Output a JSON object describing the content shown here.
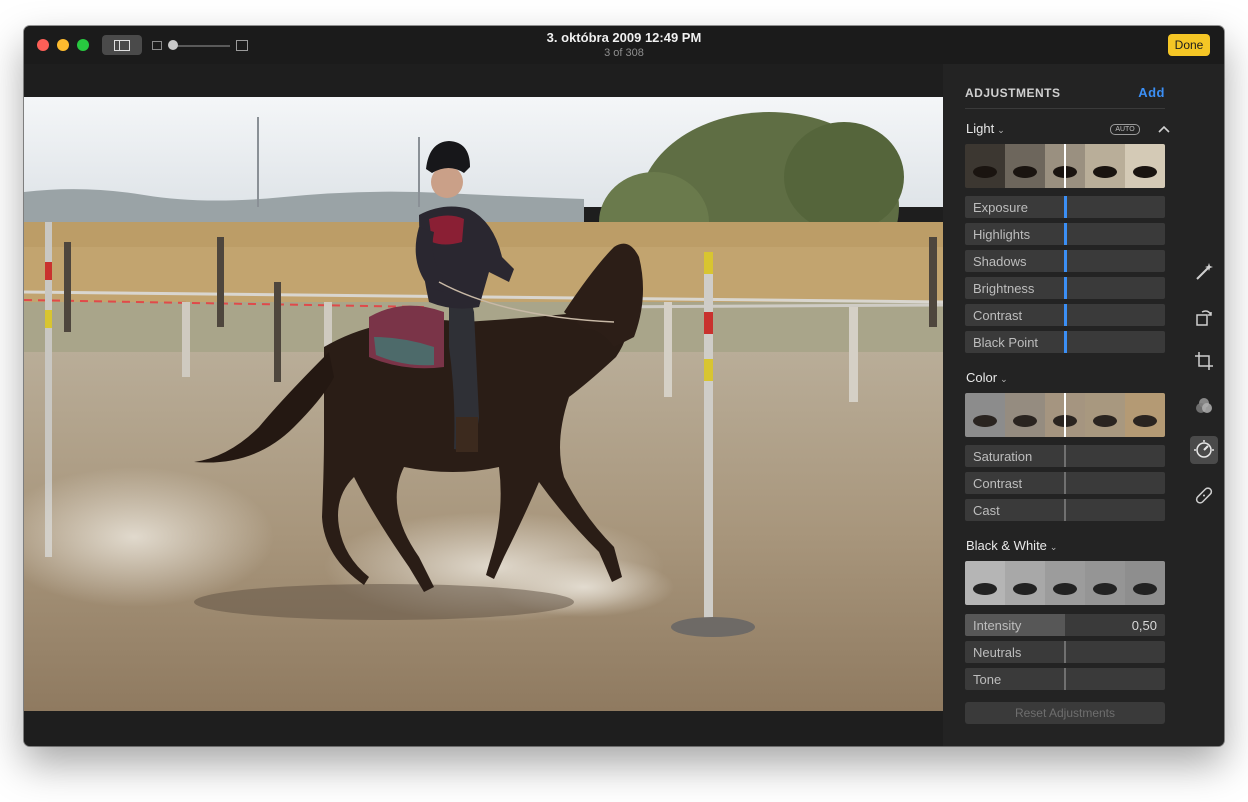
{
  "window": {
    "title": "3. októbra 2009 12:49 PM",
    "subtitle": "3 of 308",
    "done_label": "Done",
    "accent_color": "#f5c625"
  },
  "adjustments": {
    "header": "ADJUSTMENTS",
    "add_label": "Add",
    "light": {
      "title": "Light",
      "auto_label": "AUTO",
      "rows": [
        {
          "label": "Exposure"
        },
        {
          "label": "Highlights"
        },
        {
          "label": "Shadows"
        },
        {
          "label": "Brightness"
        },
        {
          "label": "Contrast"
        },
        {
          "label": "Black Point"
        }
      ]
    },
    "color": {
      "title": "Color",
      "rows": [
        {
          "label": "Saturation"
        },
        {
          "label": "Contrast"
        },
        {
          "label": "Cast"
        }
      ]
    },
    "bw": {
      "title": "Black & White",
      "rows": [
        {
          "label": "Intensity",
          "value": "0,50",
          "level": 0.5
        },
        {
          "label": "Neutrals"
        },
        {
          "label": "Tone"
        }
      ]
    },
    "reset_label": "Reset Adjustments"
  },
  "tools": [
    "magic-wand-icon",
    "rotate-icon",
    "crop-icon",
    "filters-icon",
    "adjust-icon",
    "retouch-icon"
  ],
  "link_color": "#3b8ff5"
}
